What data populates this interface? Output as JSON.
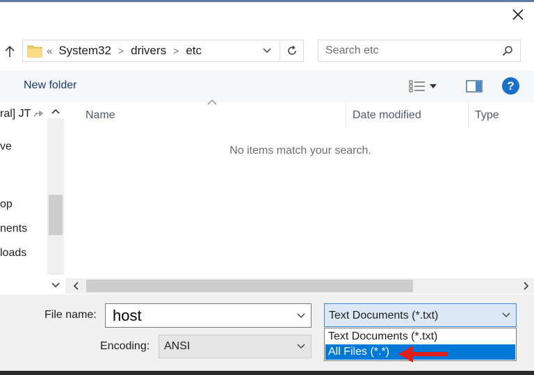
{
  "dialog": {
    "close_icon": "close-icon"
  },
  "address": {
    "overflow": "«",
    "crumbs": [
      "System32",
      "drivers",
      "etc"
    ],
    "refresh_icon": "refresh-icon"
  },
  "search": {
    "placeholder": "Search etc"
  },
  "toolbar": {
    "new_folder": "New folder",
    "help": "?"
  },
  "nav": {
    "items": [
      "ral] JT",
      "ve",
      "op",
      "nents",
      "loads"
    ]
  },
  "list": {
    "columns": [
      "Name",
      "Date modified",
      "Type"
    ],
    "empty_message": "No items match your search."
  },
  "save": {
    "file_name_label": "File name:",
    "file_name_value": "host",
    "encoding_label": "Encoding:",
    "encoding_value": "ANSI",
    "file_type_value": "Text Documents (*.txt)",
    "file_type_options": [
      "Text Documents (*.txt)",
      "All Files  (*.*)"
    ],
    "selected_option_index": 1
  },
  "colors": {
    "accent": "#0078d7",
    "arrow": "#e21b1b",
    "help": "#1a6fc9"
  }
}
